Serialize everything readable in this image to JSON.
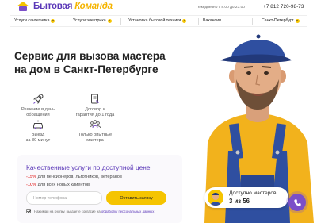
{
  "header": {
    "logo_part1": "Бытовая",
    "logo_part2": "Команда",
    "hours": "ежедневно с 8:00 до 23:00",
    "phone": "+7 812 720-98-73"
  },
  "nav": {
    "items": [
      {
        "label": "Услуги сантехника",
        "dropdown": true
      },
      {
        "label": "Услуги электрика",
        "dropdown": true
      },
      {
        "label": "Установка бытовой техники",
        "dropdown": true
      },
      {
        "label": "Вакансии",
        "dropdown": false
      },
      {
        "label": "Санкт-Петербург",
        "dropdown": true
      }
    ]
  },
  "hero": {
    "title_line1": "Сервис для вызова мастера",
    "title_line2": "на дом в Санкт-Петербурге"
  },
  "features": [
    {
      "icon": "rocket-icon",
      "line1": "Решение в день",
      "line2": "обращения"
    },
    {
      "icon": "contract-icon",
      "line1": "Договор и",
      "line2": "гарантия до 1 года"
    },
    {
      "icon": "car-icon",
      "line1": "Выезд",
      "line2": "за 30 минут"
    },
    {
      "icon": "team-icon",
      "line1": "Только опытные",
      "line2": "мастера"
    }
  ],
  "promo": {
    "title": "Качественные услуги по доступной цене",
    "discount1_pct": "-15%",
    "discount1_text": " для пенсионеров, льготников, ветеранов",
    "discount2_pct": "-10%",
    "discount2_text": " для всех новых клиентов",
    "phone_placeholder": "Номер телефона",
    "submit_label": "Оставить заявку",
    "consent_text": "Нажимая на кнопку, вы даете согласие на ",
    "consent_link": "обработку персональных данных"
  },
  "masters_badge": {
    "label": "Доступно мастеров:",
    "count": "3 из 56"
  },
  "colors": {
    "brand_purple": "#5b38b8",
    "brand_yellow": "#f5c400",
    "discount_red": "#e64a4a",
    "fab_purple": "#7b4fc8"
  }
}
